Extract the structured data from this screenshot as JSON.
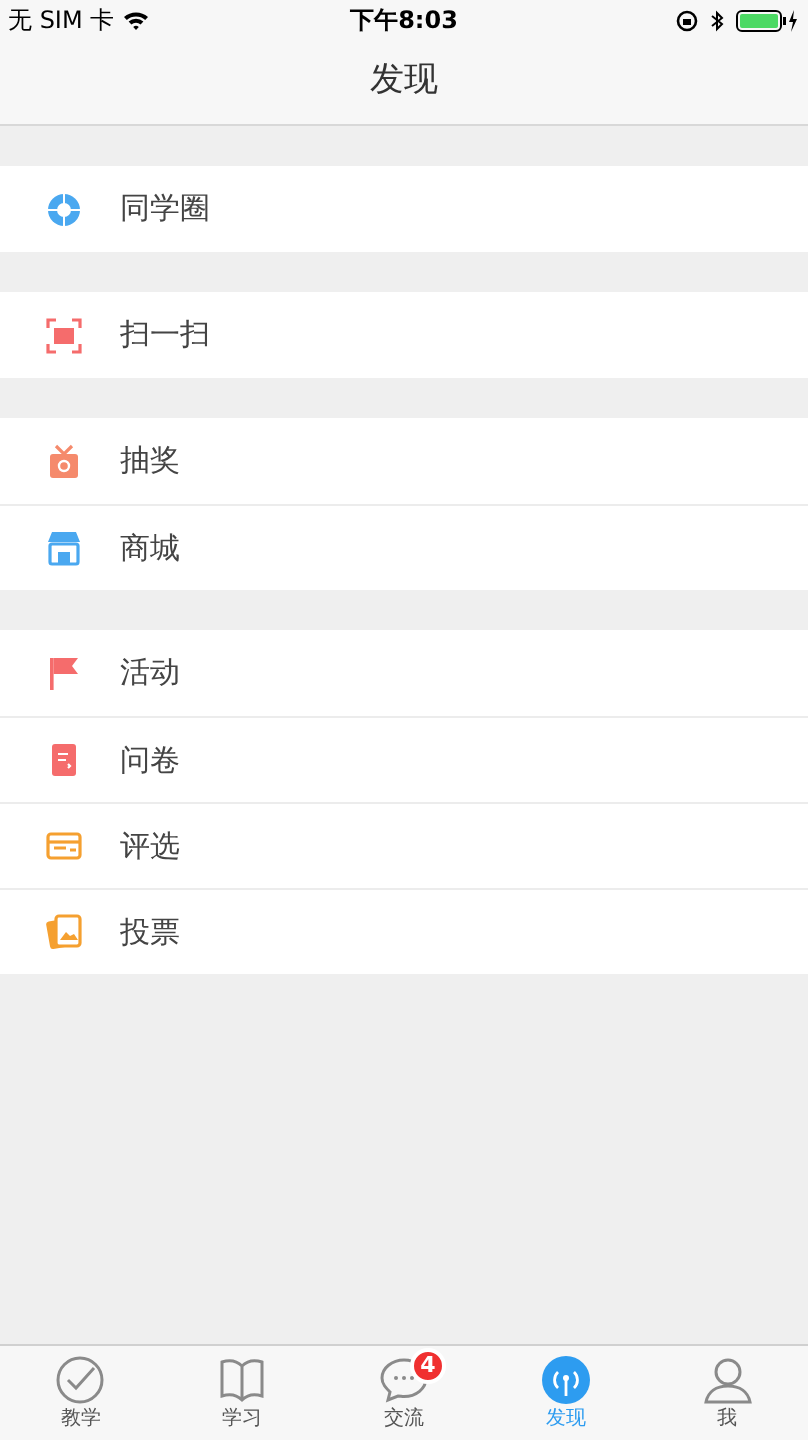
{
  "status_bar": {
    "carrier": "无 SIM 卡",
    "time": "下午8:03"
  },
  "nav": {
    "title": "发现"
  },
  "groups": [
    {
      "items": [
        {
          "label": "同学圈"
        }
      ]
    },
    {
      "items": [
        {
          "label": "扫一扫"
        }
      ]
    },
    {
      "items": [
        {
          "label": "抽奖"
        },
        {
          "label": "商城"
        }
      ]
    },
    {
      "items": [
        {
          "label": "活动"
        },
        {
          "label": "问卷"
        },
        {
          "label": "评选"
        },
        {
          "label": "投票"
        }
      ]
    }
  ],
  "tabs": [
    {
      "label": "教学",
      "selected": false
    },
    {
      "label": "学习",
      "selected": false
    },
    {
      "label": "交流",
      "selected": false,
      "badge": "4"
    },
    {
      "label": "发现",
      "selected": true
    },
    {
      "label": "我",
      "selected": false
    }
  ]
}
